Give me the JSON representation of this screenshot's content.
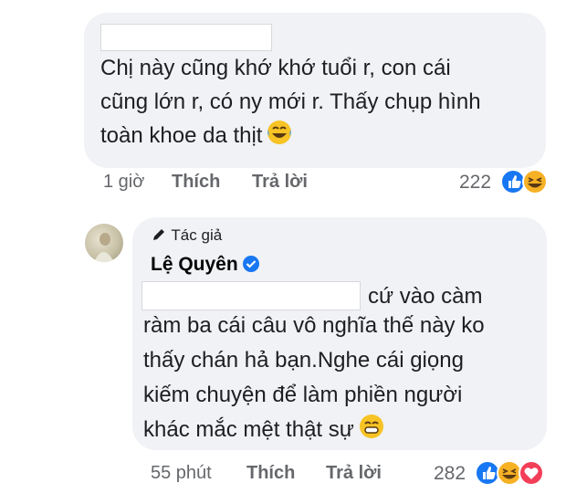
{
  "comment1": {
    "text": "Chị này cũng khớ khớ tuổi r, con cái\ncũng lớn r, có ny mới r. Thấy chụp hình\ntoàn khoe da thịt",
    "time": "1 giờ",
    "like_label": "Thích",
    "reply_label": "Trả lời",
    "reaction_count": "222",
    "reactions": [
      "like",
      "haha"
    ]
  },
  "reply": {
    "author_tag": "Tác giả",
    "author_name": "Lệ Quyên",
    "text_first": "cứ vào càm",
    "text_rest": "ràm ba cái câu vô nghĩa thế này ko\nthấy chán hả bạn.Nghe cái giọng\nkiếm chuyện để làm phiền người\nkhác mắc mệt thật sự",
    "time": "55 phút",
    "like_label": "Thích",
    "reply_label": "Trả lời",
    "reaction_count": "282",
    "reactions": [
      "like",
      "haha",
      "love"
    ]
  },
  "colors": {
    "bubble": "#f0f2f5",
    "meta": "#65676b",
    "like_blue": "#1877f2",
    "haha_yellow": "#f7b125",
    "love_red": "#f33e58"
  }
}
